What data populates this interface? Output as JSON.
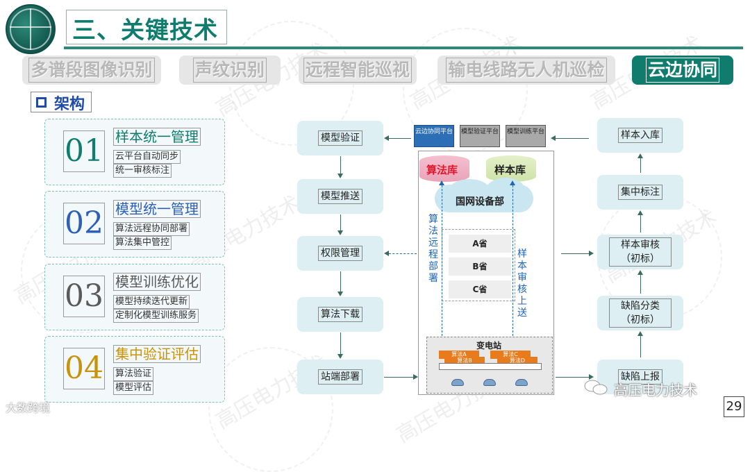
{
  "header": {
    "title": "三、关键技术"
  },
  "tabs": [
    {
      "label": "多谱段图像识别",
      "active": false
    },
    {
      "label": "声纹识别",
      "active": false
    },
    {
      "label": "远程智能巡视",
      "active": false
    },
    {
      "label": "输电线路无人机巡检",
      "active": false
    },
    {
      "label": "云边协同",
      "active": true
    }
  ],
  "section": {
    "label": "架构"
  },
  "cards": [
    {
      "num": "01",
      "title": "样本统一管理",
      "subs": [
        "云平台自动同步",
        "统一审核标注"
      ],
      "color": "#0f7c6e"
    },
    {
      "num": "02",
      "title": "模型统一管理",
      "subs": [
        "算法远程协同部署",
        "算法集中管控"
      ],
      "color": "#2d5fb5"
    },
    {
      "num": "03",
      "title": "模型训练优化",
      "subs": [
        "模型持续迭代更新",
        "定制化模型训练服务"
      ],
      "color": "#5a5a5a"
    },
    {
      "num": "04",
      "title": "集中验证评估",
      "subs": [
        "算法验证",
        "模型评估"
      ],
      "color": "#c8920a"
    }
  ],
  "left_flow": [
    "模型验证",
    "模型推送",
    "权限管理",
    "算法下载",
    "站端部署"
  ],
  "right_flow": [
    "样本入库",
    "集中标注",
    "样本审核（初标）",
    "缺陷分类（初标）",
    "缺陷上报"
  ],
  "platforms": [
    {
      "label": "云边协同平台",
      "style": "blue"
    },
    {
      "label": "模型验证平台",
      "style": "gray"
    },
    {
      "label": "模型训练平台",
      "style": "gray"
    }
  ],
  "center": {
    "algo_lib": "算法库",
    "sample_lib": "样本库",
    "cloud": "国网设备部",
    "provinces": [
      "A省",
      "B省",
      "C省"
    ],
    "left_vertical": "算法远程部署",
    "right_vertical": "样本审核上送",
    "substation": "变电站",
    "algos": [
      "算法A",
      "算法B",
      "算法C",
      "算法D"
    ]
  },
  "footer": {
    "left_watermark": "大数跨境",
    "wechat_label": "高压电力技术",
    "page_number": "29"
  },
  "watermark_text": "高压电力技术",
  "colors": {
    "accent": "#0f7c6e",
    "blue": "#1f66b8",
    "orange": "#e87b1c"
  }
}
